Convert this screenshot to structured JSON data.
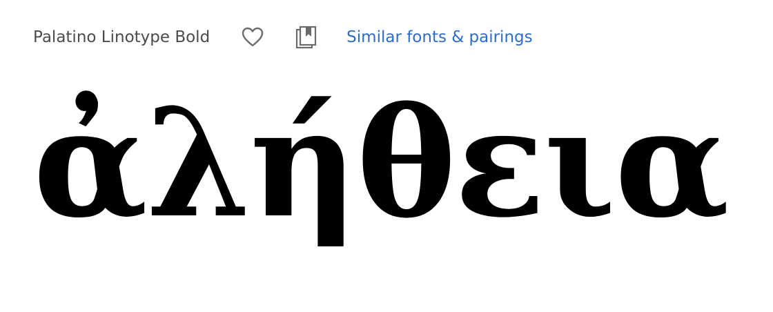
{
  "header": {
    "font_name": "Palatino Linotype Bold",
    "favorite_icon": "heart-icon",
    "collection_icon": "collection-icon",
    "similar_link_label": "Similar fonts & pairings"
  },
  "sample": {
    "text": "ἀλήθεια"
  },
  "colors": {
    "text_gray": "#4b4b4b",
    "link_blue": "#2c6ccd",
    "icon_gray": "#6b6b6b",
    "sample_black": "#000000"
  }
}
